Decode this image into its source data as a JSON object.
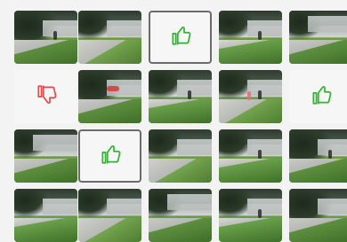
{
  "ui": {
    "title": "",
    "colors": {
      "like": "#34b233",
      "dislike": "#e04b4b",
      "background": "#f3f3f3"
    }
  },
  "tiles": [
    {
      "kind": "photo",
      "name": "camera-thumbnail",
      "variant": "variant-c"
    },
    {
      "kind": "photo",
      "name": "camera-thumbnail",
      "variant": "variant-a"
    },
    {
      "kind": "feedback",
      "name": "like-tile",
      "icon": "thumbs-up-icon",
      "selected": true
    },
    {
      "kind": "photo",
      "name": "camera-thumbnail",
      "variant": "variant-b"
    },
    {
      "kind": "photo",
      "name": "camera-thumbnail",
      "variant": "variant-d"
    },
    {
      "kind": "feedback",
      "name": "dislike-tile",
      "icon": "thumbs-down-icon",
      "selected": false
    },
    {
      "kind": "photo",
      "name": "camera-thumbnail",
      "variant": "variant-c"
    },
    {
      "kind": "photo",
      "name": "camera-thumbnail",
      "variant": "variant-b"
    },
    {
      "kind": "photo",
      "name": "camera-thumbnail",
      "variant": "variant-a"
    },
    {
      "kind": "feedback",
      "name": "like-tile",
      "icon": "thumbs-up-icon",
      "selected": false
    },
    {
      "kind": "photo",
      "name": "camera-thumbnail",
      "variant": "variant-d"
    },
    {
      "kind": "feedback",
      "name": "like-tile",
      "icon": "thumbs-up-icon",
      "selected": true
    },
    {
      "kind": "photo",
      "name": "camera-thumbnail",
      "variant": "variant-a"
    },
    {
      "kind": "photo",
      "name": "camera-thumbnail",
      "variant": "variant-b"
    },
    {
      "kind": "photo",
      "name": "camera-thumbnail",
      "variant": "variant-c"
    },
    {
      "kind": "photo",
      "name": "camera-thumbnail",
      "variant": "variant-b"
    },
    {
      "kind": "photo",
      "name": "camera-thumbnail",
      "variant": "variant-a"
    },
    {
      "kind": "photo",
      "name": "camera-thumbnail",
      "variant": "variant-d"
    },
    {
      "kind": "photo",
      "name": "camera-thumbnail",
      "variant": "variant-b"
    },
    {
      "kind": "photo",
      "name": "camera-thumbnail",
      "variant": "variant-c"
    }
  ]
}
